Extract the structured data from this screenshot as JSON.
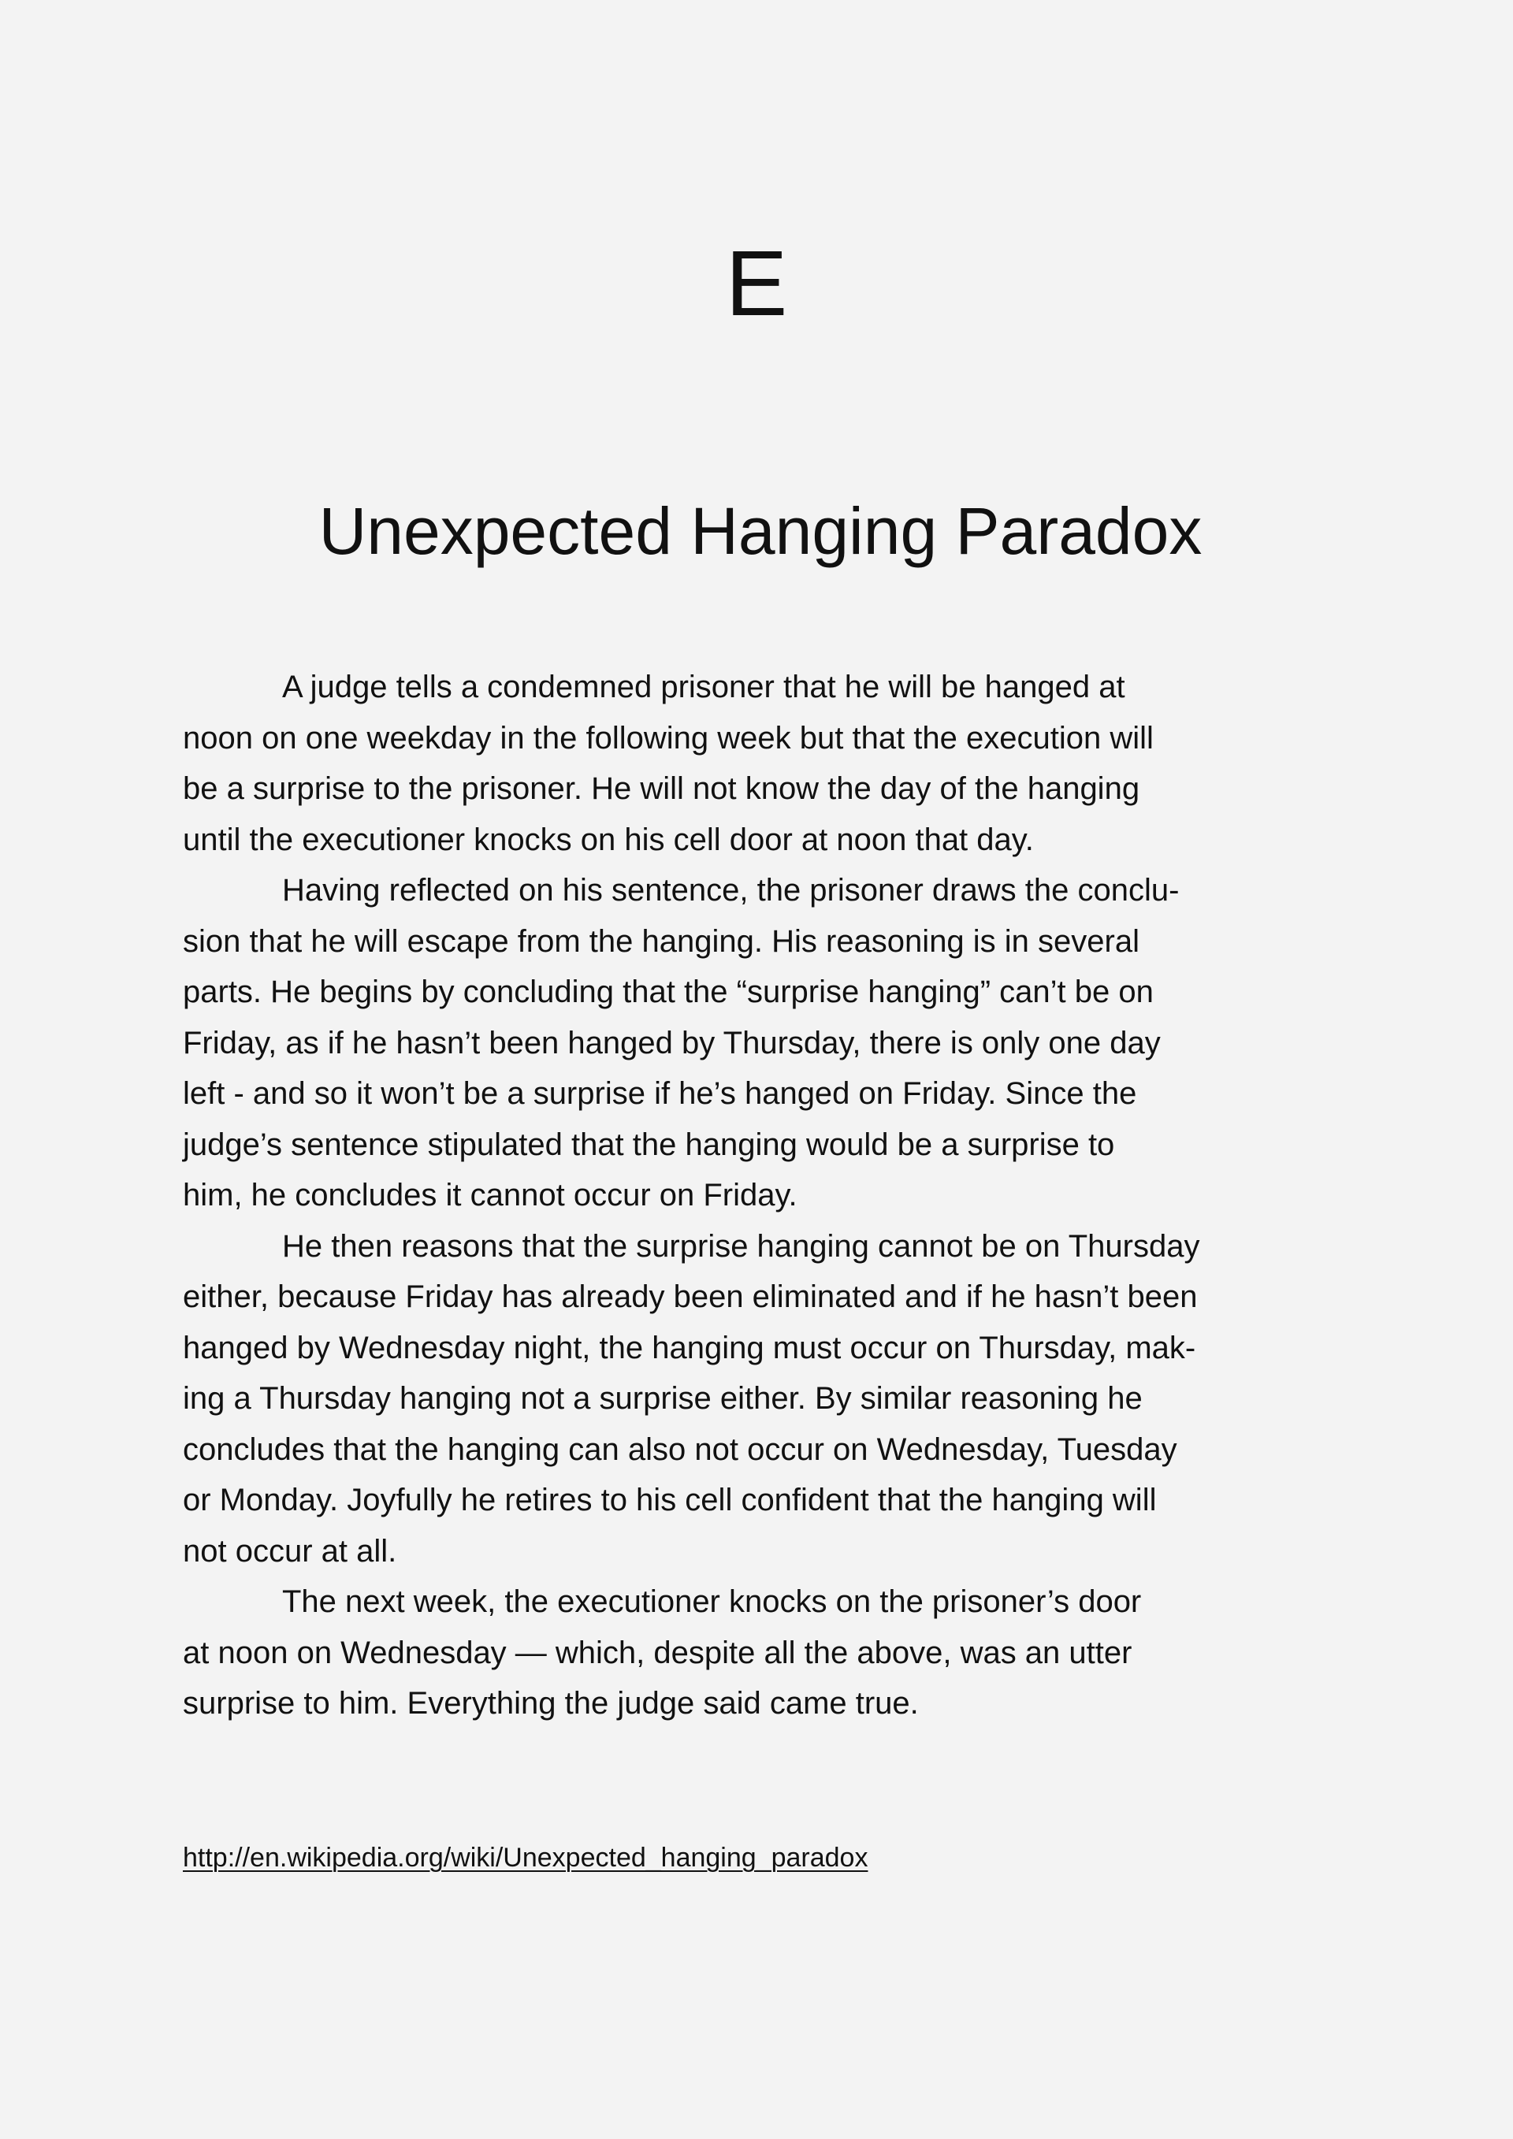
{
  "document": {
    "section_letter": "E",
    "title": "Unexpected Hanging Paradox",
    "lines": [
      {
        "text": "A judge tells a condemned prisoner that he will be hanged at",
        "indent": true
      },
      {
        "text": "noon on one weekday in the following week but that the execution will",
        "indent": false
      },
      {
        "text": "be a surprise to the prisoner. He will not know the day of the hanging",
        "indent": false
      },
      {
        "text": "until the executioner knocks on his cell door at noon that day.",
        "indent": false
      },
      {
        "text": "Having reflected on his sentence, the prisoner draws the conclu-",
        "indent": true
      },
      {
        "text": "sion that he will escape from the hanging. His reasoning is in several",
        "indent": false
      },
      {
        "text": "parts. He begins by concluding that the “surprise hanging” can’t be on",
        "indent": false
      },
      {
        "text": "Friday, as if he hasn’t been hanged by Thursday, there is only one day",
        "indent": false
      },
      {
        "text": "left - and so it won’t be a surprise if he’s hanged on Friday. Since the",
        "indent": false
      },
      {
        "text": "judge’s sentence stipulated that the hanging would be a surprise to",
        "indent": false
      },
      {
        "text": "him, he concludes it cannot occur on Friday.",
        "indent": false
      },
      {
        "text": "He then reasons that the surprise hanging cannot be on Thursday",
        "indent": true
      },
      {
        "text": "either, because Friday has already been eliminated and if he hasn’t been",
        "indent": false
      },
      {
        "text": "hanged by Wednesday night, the hanging must occur on Thursday, mak-",
        "indent": false
      },
      {
        "text": "ing a Thursday hanging not a surprise either. By similar reasoning he",
        "indent": false
      },
      {
        "text": "concludes that the hanging can also not occur on Wednesday, Tuesday",
        "indent": false
      },
      {
        "text": "or Monday. Joyfully he retires to his cell confident that the hanging will",
        "indent": false
      },
      {
        "text": "not occur at all.",
        "indent": false
      },
      {
        "text": "The next week, the executioner knocks on the prisoner’s door",
        "indent": true
      },
      {
        "text": "at noon on Wednesday — which, despite all the above, was an utter",
        "indent": false
      },
      {
        "text": "surprise to him. Everything the judge said came true.",
        "indent": false
      }
    ],
    "source_link": "http://en.wikipedia.org/wiki/Unexpected_hanging_paradox"
  }
}
